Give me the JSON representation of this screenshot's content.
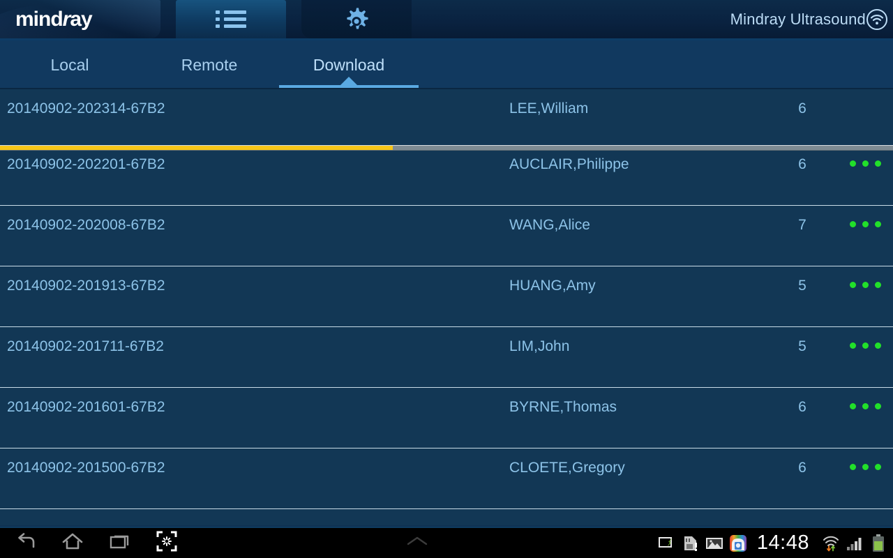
{
  "header": {
    "logo": "mindray",
    "logo_plain_1": "mind",
    "logo_italic": "r",
    "logo_plain_2": "ay",
    "tabs": [
      {
        "id": "worklist",
        "icon": "list-icon",
        "active": true
      },
      {
        "id": "settings",
        "icon": "gear-icon",
        "active": false
      }
    ],
    "title": "Mindray Ultrasound",
    "connection_icon": "wifi-circle-icon"
  },
  "subtabs": {
    "items": [
      {
        "label": "Local",
        "selected": false
      },
      {
        "label": "Remote",
        "selected": false
      },
      {
        "label": "Download",
        "selected": true
      }
    ]
  },
  "list": {
    "downloading": {
      "id": "20140902-202314-67B2",
      "name": "LEE,William",
      "count": "6",
      "progress_percent": 44,
      "progress_color": "#f5c518",
      "track_color": "#7e8b93"
    },
    "rows": [
      {
        "id": "20140902-202201-67B2",
        "name": "AUCLAIR,Philippe",
        "count": "6",
        "status_icon": "three-green-dots"
      },
      {
        "id": "20140902-202008-67B2",
        "name": "WANG,Alice",
        "count": "7",
        "status_icon": "three-green-dots"
      },
      {
        "id": "20140902-201913-67B2",
        "name": "HUANG,Amy",
        "count": "5",
        "status_icon": "three-green-dots"
      },
      {
        "id": "20140902-201711-67B2",
        "name": "LIM,John",
        "count": "5",
        "status_icon": "three-green-dots"
      },
      {
        "id": "20140902-201601-67B2",
        "name": "BYRNE,Thomas",
        "count": "6",
        "status_icon": "three-green-dots"
      },
      {
        "id": "20140902-201500-67B2",
        "name": "CLOETE,Gregory",
        "count": "6",
        "status_icon": "three-green-dots"
      }
    ]
  },
  "navbar": {
    "back_icon": "back-arrow-icon",
    "home_icon": "home-icon",
    "recents_icon": "recent-apps-icon",
    "screenshot_icon": "screen-capture-icon",
    "expand_icon": "chevron-up-icon",
    "status_icons": [
      "screen-cast-icon",
      "sd-card-warning-icon",
      "image-icon",
      "app-store-icon"
    ],
    "clock": "14:48",
    "wifi_icon": "wifi-transfer-icon",
    "signal_icon": "cellular-signal-icon",
    "battery_icon": "battery-icon"
  },
  "colors": {
    "background": "#123755",
    "header_dark": "#06182f",
    "accent_blue": "#5aa9e2",
    "text_blue": "#8dc3e8",
    "progress_yellow": "#f5c518",
    "status_green": "#22e02a"
  }
}
